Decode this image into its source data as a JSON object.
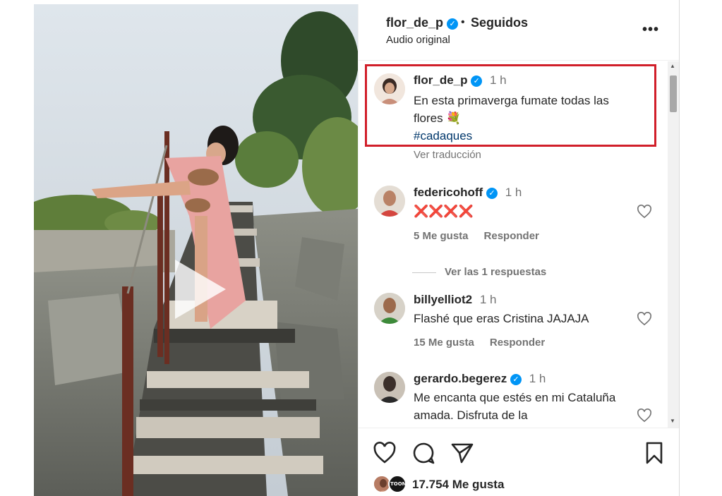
{
  "header": {
    "username": "flor_de_p",
    "separator": "•",
    "follow_status": "Seguidos",
    "audio_label": "Audio original",
    "more_label": "•••"
  },
  "caption": {
    "username": "flor_de_p",
    "time": "1 h",
    "text": "En esta primaverga fumate todas las flores 💐",
    "hashtag": "#cadaques",
    "translate_label": "Ver traducción"
  },
  "comments": [
    {
      "username": "federicohoff",
      "verified": true,
      "time": "1 h",
      "text": "❌❌❌❌",
      "likes": "5 Me gusta",
      "reply_label": "Responder"
    },
    {
      "username": "billyelliot2",
      "verified": false,
      "time": "1 h",
      "text": "Flashé que eras Cristina JAJAJA",
      "likes": "15 Me gusta",
      "reply_label": "Responder"
    },
    {
      "username": "gerardo.begerez",
      "verified": true,
      "time": "1 h",
      "text": "Me encanta que estés en mi Cataluña amada. Disfruta de la"
    }
  ],
  "view_replies": "Ver las 1 respuestas",
  "footer": {
    "likes_count": "17.754 Me gusta",
    "liker_badge": "TOON"
  },
  "icons": {
    "like": "heart-icon",
    "comment": "comment-icon",
    "share": "send-icon",
    "save": "bookmark-icon",
    "play": "play-icon"
  },
  "colors": {
    "verified": "#0095f6",
    "highlight_border": "#d11f2a",
    "hashtag": "#00376b",
    "muted": "#737373"
  }
}
